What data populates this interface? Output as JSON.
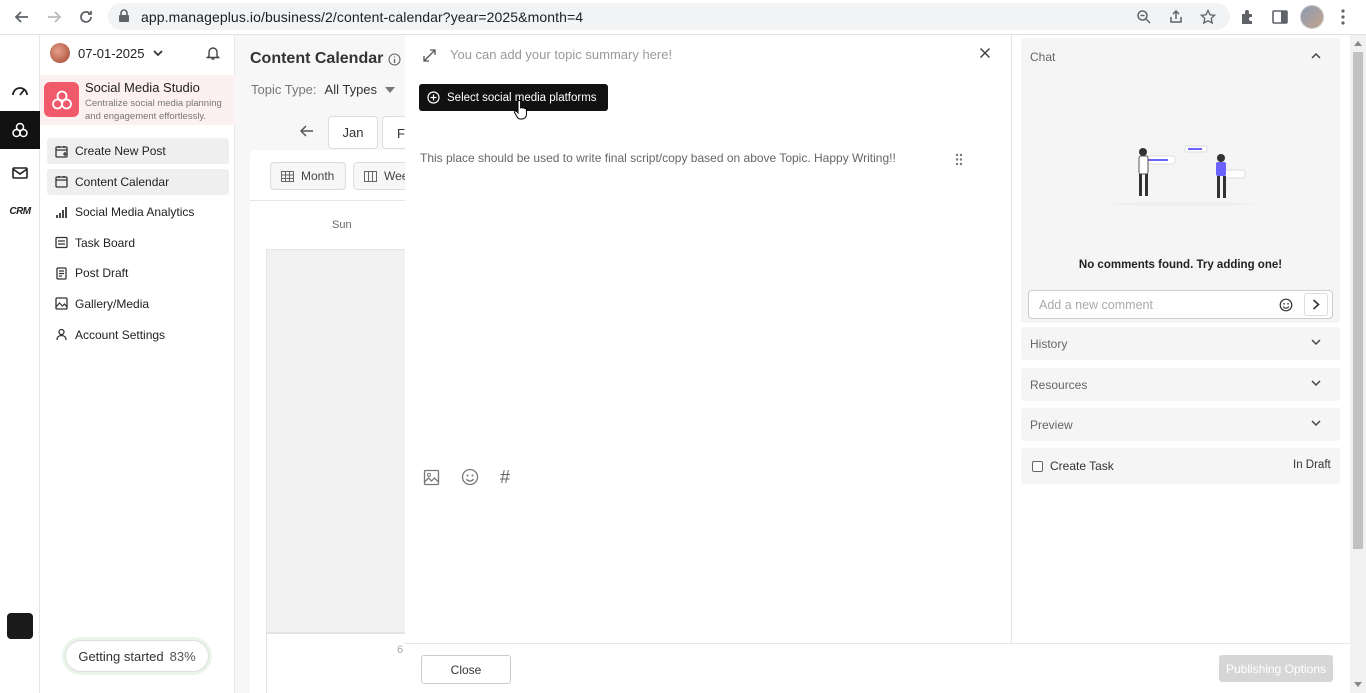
{
  "browser": {
    "url": "app.manageplus.io/business/2/content-calendar?year=2025&month=4"
  },
  "sidebar": {
    "date": "07-01-2025",
    "studio_title": "Social Media Studio",
    "studio_desc": "Centralize social media planning and engagement effortlessly.",
    "items": [
      {
        "label": "Create New Post",
        "icon": "calendar-plus-icon"
      },
      {
        "label": "Content Calendar",
        "icon": "calendar-icon"
      },
      {
        "label": "Social Media Analytics",
        "icon": "bar-chart-icon"
      },
      {
        "label": "Task Board",
        "icon": "list-icon"
      },
      {
        "label": "Post Draft",
        "icon": "document-icon"
      },
      {
        "label": "Gallery/Media",
        "icon": "image-icon"
      },
      {
        "label": "Account Settings",
        "icon": "user-icon"
      }
    ],
    "getting_started": {
      "label": "Getting started",
      "pct": "83%",
      "progress": 0.83
    }
  },
  "rail": {
    "crm_label": "CRM"
  },
  "calendar": {
    "title": "Content Calendar",
    "topic_type_label": "Topic Type:",
    "topic_type_value": "All Types",
    "month_current": "Jan",
    "month_next": "F",
    "view_month": "Month",
    "view_week": "Wee",
    "day_sun": "Sun",
    "day_num": "6"
  },
  "editor": {
    "summary_placeholder": "You can add your topic summary here!",
    "platform_button": "Select social media platforms",
    "script_placeholder": "This place should be used to write final script/copy based on above Topic. Happy Writing!!",
    "hash_symbol": "#",
    "close_button": "Close",
    "publishing_button": "Publishing Options"
  },
  "right_panel": {
    "chat_label": "Chat",
    "no_comments": "No comments found. Try adding one!",
    "comment_placeholder": "Add a new comment",
    "history_label": "History",
    "resources_label": "Resources",
    "preview_label": "Preview",
    "create_task_label": "Create Task",
    "status": "In Draft"
  },
  "colors": {
    "studio_accent": "#f15a6b",
    "studio_bg": "#fdf0f1",
    "primary_button": "#111111"
  }
}
